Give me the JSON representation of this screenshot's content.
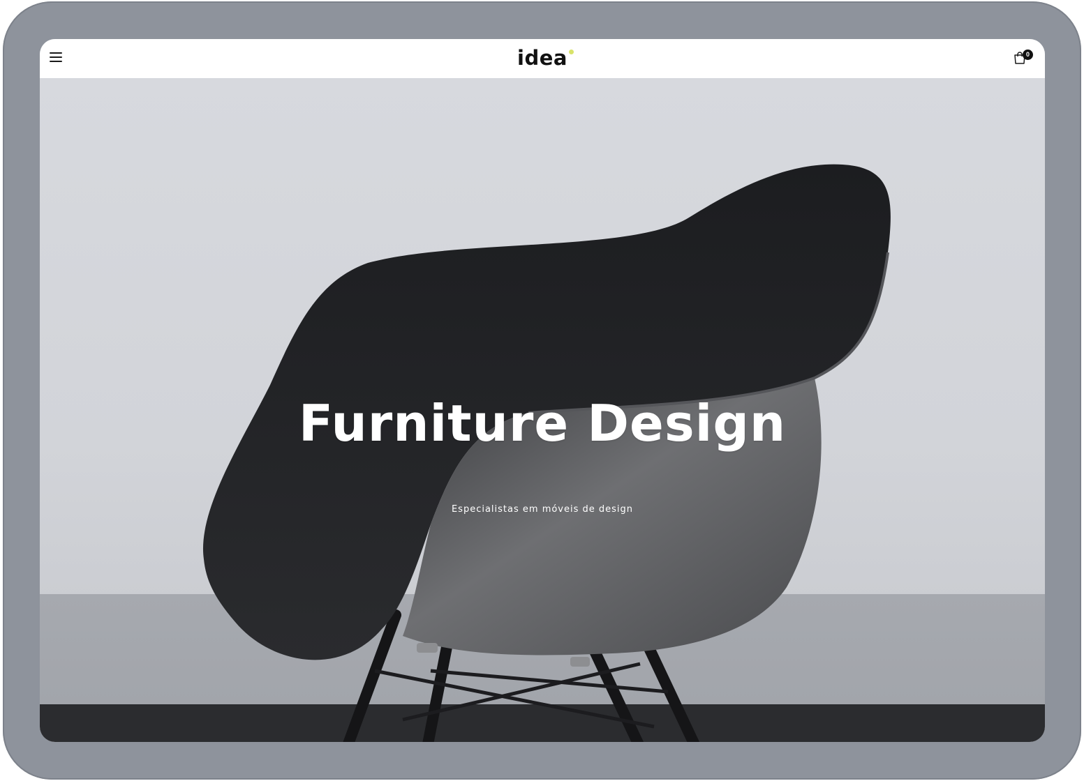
{
  "header": {
    "logo_text": "idea",
    "logo_dot_color": "#d9e36a",
    "menu_icon": "hamburger-menu-icon",
    "cart_icon": "shopping-bag-icon",
    "cart_count": "0"
  },
  "hero": {
    "title": "Furniture Design",
    "subtitle": "Especialistas em móveis de design",
    "image": "black-shell-armchair-photo"
  },
  "colors": {
    "frame": "#8e939c",
    "header_bg": "#ffffff",
    "hero_text": "#ffffff",
    "accent_dot": "#d9e36a"
  }
}
